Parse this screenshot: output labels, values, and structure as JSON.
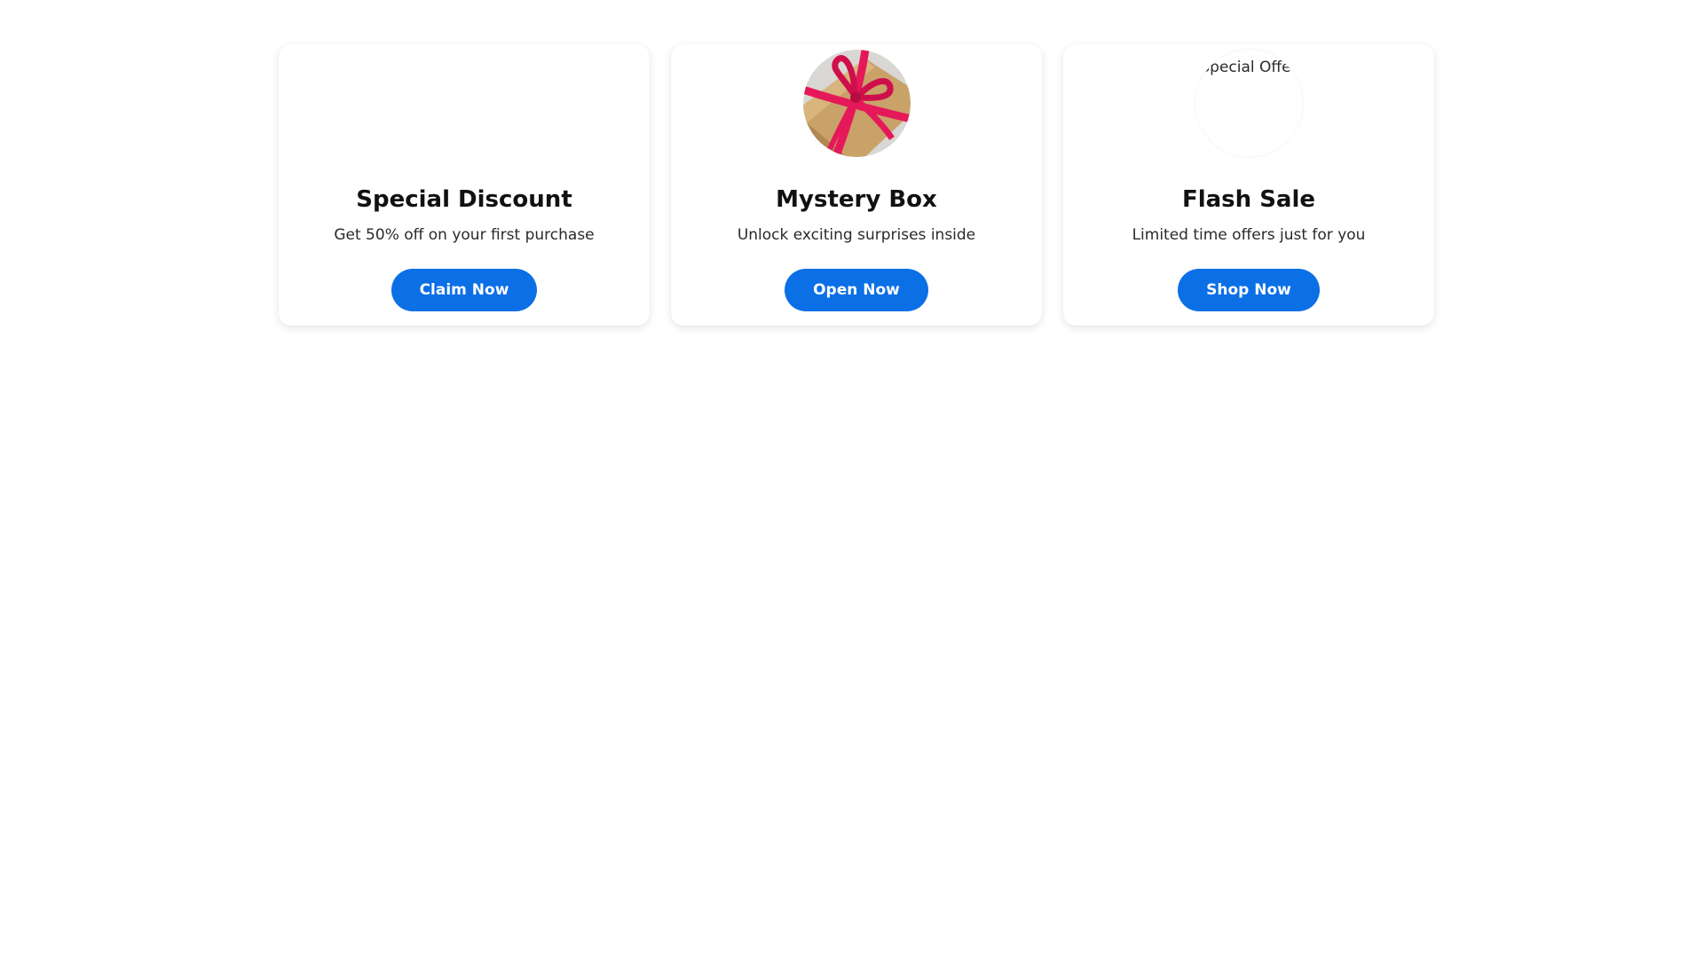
{
  "colors": {
    "accent": "#0b6fe6",
    "gift_ribbon": "#e5195a",
    "gift_box": "#c9a26a"
  },
  "cards": [
    {
      "title": "Special Discount",
      "description": "Get 50% off on your first purchase",
      "button_label": "Claim Now",
      "image": "empty"
    },
    {
      "title": "Mystery Box",
      "description": "Unlock exciting surprises inside",
      "button_label": "Open Now",
      "image": "gift-box-icon"
    },
    {
      "title": "Flash Sale",
      "description": "Limited time offers just for you",
      "button_label": "Shop Now",
      "image": "broken-image",
      "image_alt": "Special Offer"
    }
  ]
}
